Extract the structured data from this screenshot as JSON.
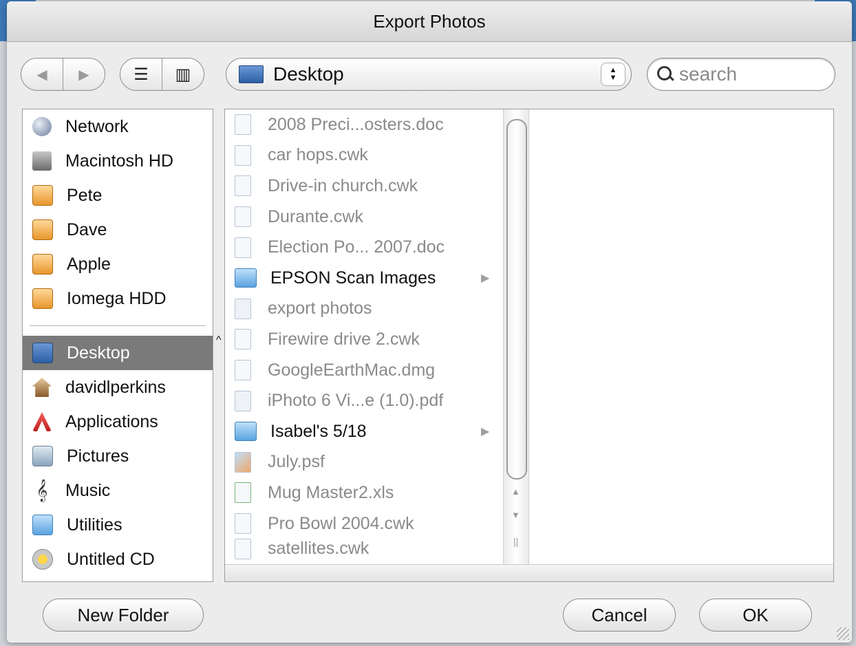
{
  "dialog": {
    "title": "Export Photos"
  },
  "toolbar": {
    "back_glyph": "◀",
    "forward_glyph": "▶",
    "list_view_glyph": "☰",
    "column_view_glyph": "▥",
    "location": "Desktop",
    "popup_up": "▲",
    "popup_down": "▼",
    "search_placeholder": "search"
  },
  "sidebar": {
    "devices": [
      {
        "label": "Network",
        "icon": "network-icon"
      },
      {
        "label": "Macintosh HD",
        "icon": "hard-drive-icon"
      },
      {
        "label": "Pete",
        "icon": "server-icon"
      },
      {
        "label": "Dave",
        "icon": "server-icon"
      },
      {
        "label": "Apple",
        "icon": "server-icon"
      },
      {
        "label": "Iomega HDD",
        "icon": "server-icon"
      }
    ],
    "places": [
      {
        "label": "Desktop",
        "icon": "desktop-icon",
        "selected": true
      },
      {
        "label": "davidlperkins",
        "icon": "home-icon"
      },
      {
        "label": "Applications",
        "icon": "applications-icon"
      },
      {
        "label": "Pictures",
        "icon": "pictures-icon"
      },
      {
        "label": "Music",
        "icon": "music-icon",
        "glyph": "𝄞"
      },
      {
        "label": "Utilities",
        "icon": "folder-icon"
      },
      {
        "label": "Untitled CD",
        "icon": "cd-icon"
      }
    ],
    "scroll_glyph": "^"
  },
  "browser": {
    "files": [
      {
        "name": "2008 Preci...osters.doc",
        "kind": "doc"
      },
      {
        "name": "car hops.cwk",
        "kind": "cwk"
      },
      {
        "name": "Drive-in church.cwk",
        "kind": "cwk"
      },
      {
        "name": "Durante.cwk",
        "kind": "cwk"
      },
      {
        "name": "Election Po... 2007.doc",
        "kind": "doc"
      },
      {
        "name": "EPSON Scan Images",
        "kind": "folder",
        "disclosure": "▶"
      },
      {
        "name": "export photos",
        "kind": "pdf"
      },
      {
        "name": "Firewire drive 2.cwk",
        "kind": "cwk"
      },
      {
        "name": "GoogleEarthMac.dmg",
        "kind": "dmg"
      },
      {
        "name": "iPhoto 6 Vi...e (1.0).pdf",
        "kind": "pdf"
      },
      {
        "name": "Isabel's 5/18",
        "kind": "folder",
        "disclosure": "▶"
      },
      {
        "name": "July.psf",
        "kind": "psf"
      },
      {
        "name": "Mug Master2.xls",
        "kind": "xls"
      },
      {
        "name": "Pro Bowl 2004.cwk",
        "kind": "cwk"
      },
      {
        "name": "satellites.cwk",
        "kind": "cwk"
      }
    ],
    "scroll_up": "▲",
    "scroll_down": "▼",
    "resize_glyph": "||"
  },
  "buttons": {
    "new_folder": "New Folder",
    "cancel": "Cancel",
    "ok": "OK"
  }
}
